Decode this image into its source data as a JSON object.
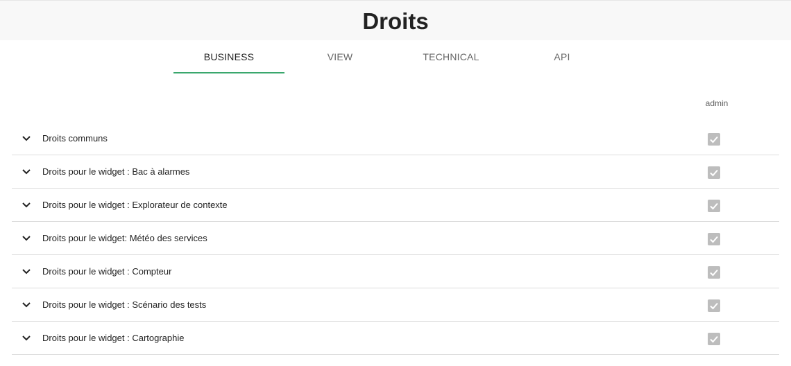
{
  "page": {
    "title": "Droits"
  },
  "tabs": [
    {
      "label": "BUSINESS",
      "active": true
    },
    {
      "label": "VIEW",
      "active": false
    },
    {
      "label": "TECHNICAL",
      "active": false
    },
    {
      "label": "API",
      "active": false
    }
  ],
  "table": {
    "column_header": "admin",
    "rows": [
      {
        "label": "Droits communs",
        "checked": true
      },
      {
        "label": "Droits pour le widget : Bac à alarmes",
        "checked": true
      },
      {
        "label": "Droits pour le widget : Explorateur de contexte",
        "checked": true
      },
      {
        "label": "Droits pour le widget: Météo des services",
        "checked": true
      },
      {
        "label": "Droits pour le widget : Compteur",
        "checked": true
      },
      {
        "label": "Droits pour le widget : Scénario des tests",
        "checked": true
      },
      {
        "label": "Droits pour le widget : Cartographie",
        "checked": true
      }
    ]
  },
  "colors": {
    "accent": "#3aa76d",
    "checkbox_disabled": "#bdbdbd"
  },
  "icons": {
    "expand": "chevron-down-icon",
    "check": "check-icon"
  }
}
